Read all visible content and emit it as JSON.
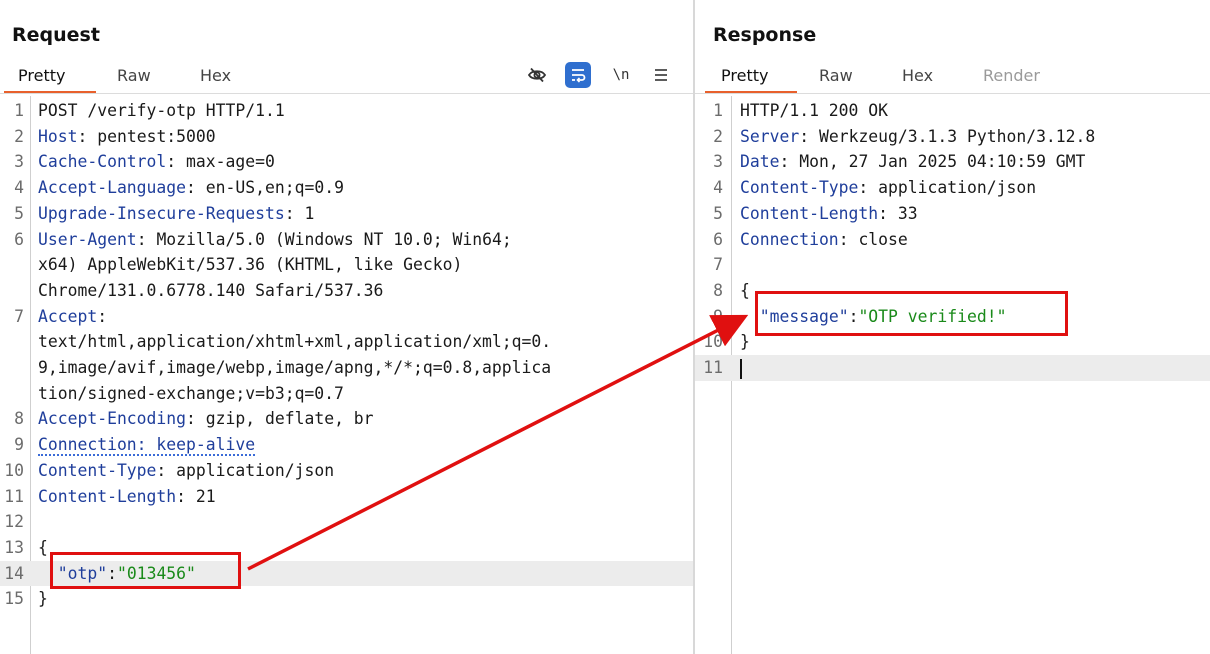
{
  "request": {
    "title": "Request",
    "tabs": [
      "Pretty",
      "Raw",
      "Hex"
    ],
    "active_tab": "Pretty",
    "toolbar": {
      "hide_icon": "eye-slash-icon",
      "wrap_icon": "word-wrap-icon",
      "newline_label": "\\n",
      "menu_icon": "hamburger-menu-icon"
    },
    "lines": [
      {
        "n": "1",
        "key": "",
        "sep": "",
        "val": "POST /verify-otp HTTP/1.1"
      },
      {
        "n": "2",
        "key": "Host",
        "sep": ": ",
        "val": "pentest:5000"
      },
      {
        "n": "3",
        "key": "Cache-Control",
        "sep": ": ",
        "val": "max-age=0"
      },
      {
        "n": "4",
        "key": "Accept-Language",
        "sep": ": ",
        "val": "en-US,en;q=0.9"
      },
      {
        "n": "5",
        "key": "Upgrade-Insecure-Requests",
        "sep": ": ",
        "val": "1"
      },
      {
        "n": "6",
        "key": "User-Agent",
        "sep": ": ",
        "val": "Mozilla/5.0 (Windows NT 10.0; Win64;"
      },
      {
        "n": "",
        "key": "",
        "sep": "",
        "val": "x64) AppleWebKit/537.36 (KHTML, like Gecko)"
      },
      {
        "n": "",
        "key": "",
        "sep": "",
        "val": "Chrome/131.0.6778.140 Safari/537.36"
      },
      {
        "n": "7",
        "key": "Accept",
        "sep": ":",
        "val": ""
      },
      {
        "n": "",
        "key": "",
        "sep": "",
        "val": "text/html,application/xhtml+xml,application/xml;q=0."
      },
      {
        "n": "",
        "key": "",
        "sep": "",
        "val": "9,image/avif,image/webp,image/apng,*/*;q=0.8,applica"
      },
      {
        "n": "",
        "key": "",
        "sep": "",
        "val": "tion/signed-exchange;v=b3;q=0.7"
      },
      {
        "n": "8",
        "key": "Accept-Encoding",
        "sep": ": ",
        "val": "gzip, deflate, br"
      },
      {
        "n": "9",
        "key": "Connection: keep-alive",
        "sep": "",
        "val": "",
        "dotted": true
      },
      {
        "n": "10",
        "key": "Content-Type",
        "sep": ": ",
        "val": "application/json"
      },
      {
        "n": "11",
        "key": "Content-Length",
        "sep": ": ",
        "val": "21"
      },
      {
        "n": "12",
        "key": "",
        "sep": "",
        "val": ""
      },
      {
        "n": "13",
        "key": "",
        "sep": "",
        "val": "{"
      },
      {
        "n": "14",
        "json": true,
        "indent": "  ",
        "jkey": "\"otp\"",
        "colon": ":",
        "jval": "\"013456\"",
        "highlight": true
      },
      {
        "n": "15",
        "key": "",
        "sep": "",
        "val": "}"
      }
    ]
  },
  "response": {
    "title": "Response",
    "tabs": [
      "Pretty",
      "Raw",
      "Hex",
      "Render"
    ],
    "active_tab": "Pretty",
    "lines": [
      {
        "n": "1",
        "key": "",
        "sep": "",
        "val": "HTTP/1.1 200 OK"
      },
      {
        "n": "2",
        "key": "Server",
        "sep": ": ",
        "val": "Werkzeug/3.1.3 Python/3.12.8"
      },
      {
        "n": "3",
        "key": "Date",
        "sep": ": ",
        "val": "Mon, 27 Jan 2025 04:10:59 GMT"
      },
      {
        "n": "4",
        "key": "Content-Type",
        "sep": ": ",
        "val": "application/json"
      },
      {
        "n": "5",
        "key": "Content-Length",
        "sep": ": ",
        "val": "33"
      },
      {
        "n": "6",
        "key": "Connection",
        "sep": ": ",
        "val": "close"
      },
      {
        "n": "7",
        "key": "",
        "sep": "",
        "val": ""
      },
      {
        "n": "8",
        "key": "",
        "sep": "",
        "val": "{"
      },
      {
        "n": "9",
        "json": true,
        "indent": "  ",
        "jkey": "\"message\"",
        "colon": ":",
        "jval": "\"OTP verified!\""
      },
      {
        "n": "10",
        "key": "",
        "sep": "",
        "val": "}"
      },
      {
        "n": "11",
        "key": "",
        "sep": "",
        "val": "",
        "cursor": true,
        "highlight": true
      }
    ]
  },
  "colors": {
    "accent_underline": "#e8602c",
    "annotation_red": "#e01010",
    "header_key_blue": "#1f3e9b",
    "json_string_green": "#1a8a1a",
    "wrap_button_blue": "#2f6fcf"
  }
}
